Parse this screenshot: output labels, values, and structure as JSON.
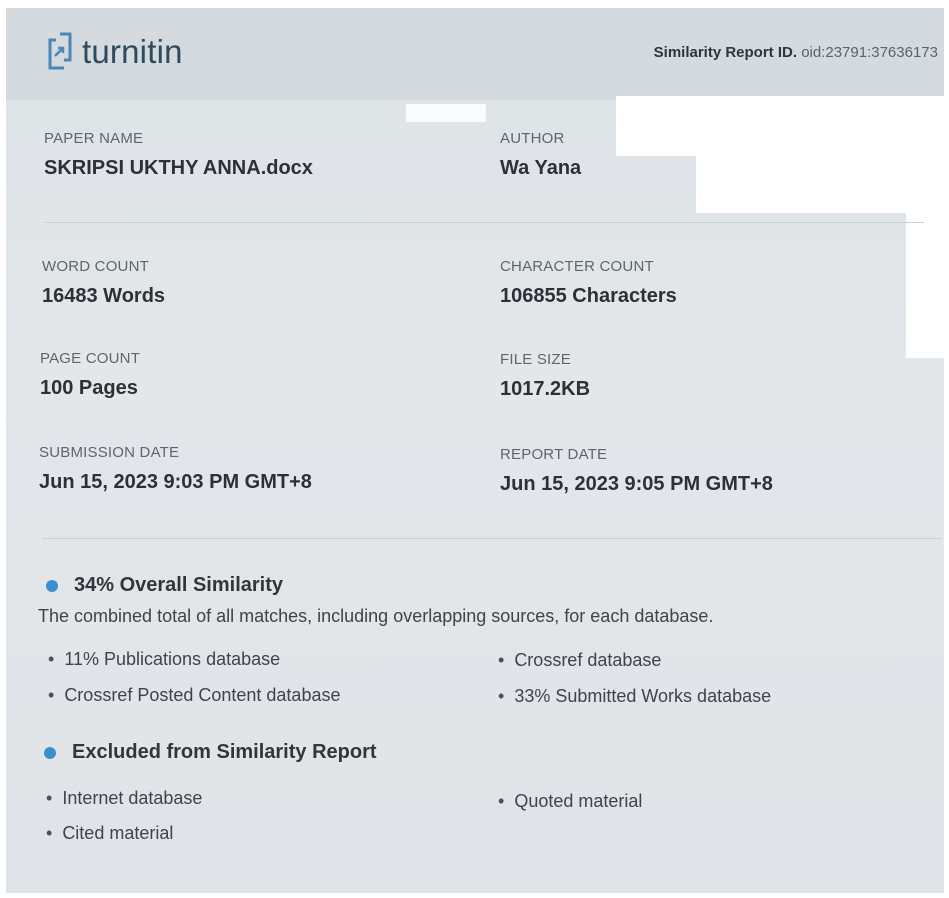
{
  "brand": {
    "logo_text": "turnitin",
    "report_id_label": "Similarity Report ID.",
    "report_id_value": "oid:23791:37636173"
  },
  "details": {
    "paper_name_label": "PAPER NAME",
    "paper_name": "SKRIPSI UKTHY ANNA.docx",
    "author_label": "AUTHOR",
    "author": "Wa  Yana",
    "word_count_label": "WORD COUNT",
    "word_count": "16483 Words",
    "character_count_label": "CHARACTER COUNT",
    "character_count": "106855 Characters",
    "page_count_label": "PAGE COUNT",
    "page_count": "100 Pages",
    "file_size_label": "FILE SIZE",
    "file_size": "1017.2KB",
    "submission_date_label": "SUBMISSION DATE",
    "submission_date": "Jun 15, 2023 9:03 PM GMT+8",
    "report_date_label": "REPORT DATE",
    "report_date": "Jun 15, 2023 9:05 PM GMT+8"
  },
  "similarity": {
    "title": "34% Overall Similarity",
    "description": "The combined total of all matches, including overlapping sources, for each database.",
    "items": [
      "11% Publications database",
      "Crossref database",
      "Crossref Posted Content database",
      "33% Submitted Works database"
    ]
  },
  "excluded": {
    "title": "Excluded from Similarity Report",
    "items": [
      "Internet database",
      "Quoted material",
      "Cited material"
    ]
  },
  "colors": {
    "accent_dot": "#3a8fd0",
    "brand_text": "#2e4a5e",
    "page_bg": "#e0e4e8"
  }
}
